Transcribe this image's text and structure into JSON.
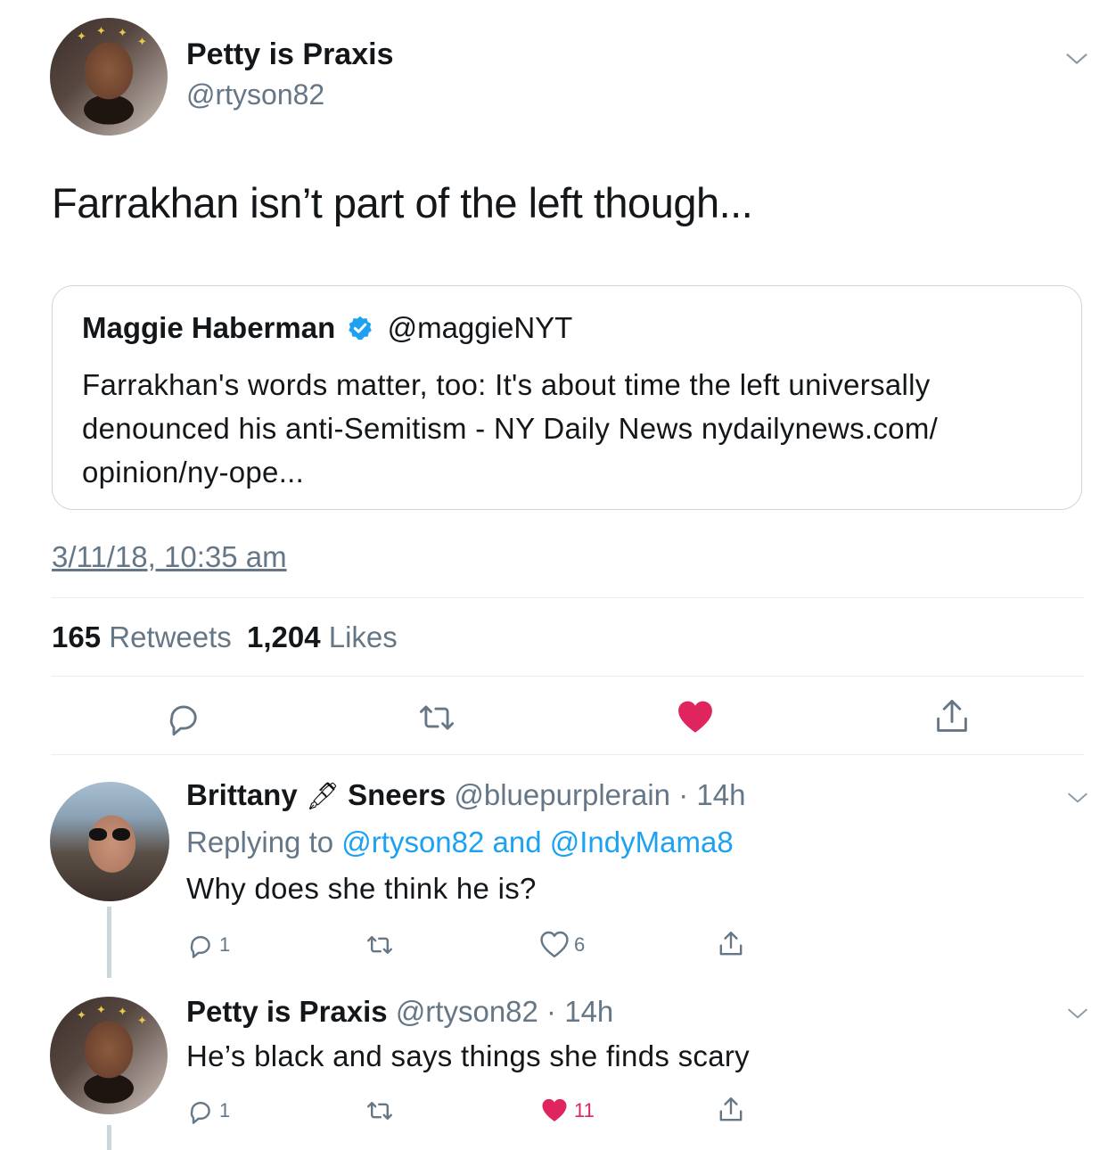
{
  "main_tweet": {
    "display_name": "Petty is Praxis",
    "handle": "@rtyson82",
    "text": "Farrakhan isn’t part of the left though...",
    "timestamp": "3/11/18, 10:35 am",
    "retweets_count": "165",
    "retweets_label": "Retweets",
    "likes_count": "1,204",
    "likes_label": "Likes"
  },
  "quoted_tweet": {
    "display_name": "Maggie Haberman",
    "handle": "@maggieNYT",
    "text": "Farrakhan's words matter, too: It's about time the left universally denounced his anti-Semitism - NY Daily News nydailynews.com/ opinion/ny-ope..."
  },
  "replies": [
    {
      "display_name_1": "Brittany",
      "display_name_emoji": "🖋",
      "display_name_2": "Sneers",
      "handle": "@bluepurplerain",
      "time": "14h",
      "replying_prefix": "Replying to",
      "replying_user1": "@rtyson82",
      "replying_and": "and",
      "replying_user2": "@IndyMama8",
      "text": "Why does she think he is?",
      "reply_count": "1",
      "like_count": "6"
    },
    {
      "display_name": "Petty is Praxis",
      "handle": "@rtyson82",
      "time": "14h",
      "text": "He’s black and says things she finds scary",
      "reply_count": "1",
      "like_count": "11"
    }
  ],
  "colors": {
    "accent_blue": "#1da1f2",
    "like_pink": "#e0245e",
    "muted_gray": "#657786",
    "border": "#ccd6dd"
  },
  "icons": [
    "chevron-down-icon",
    "verified-badge-icon",
    "reply-icon",
    "retweet-icon",
    "heart-icon",
    "share-icon"
  ]
}
